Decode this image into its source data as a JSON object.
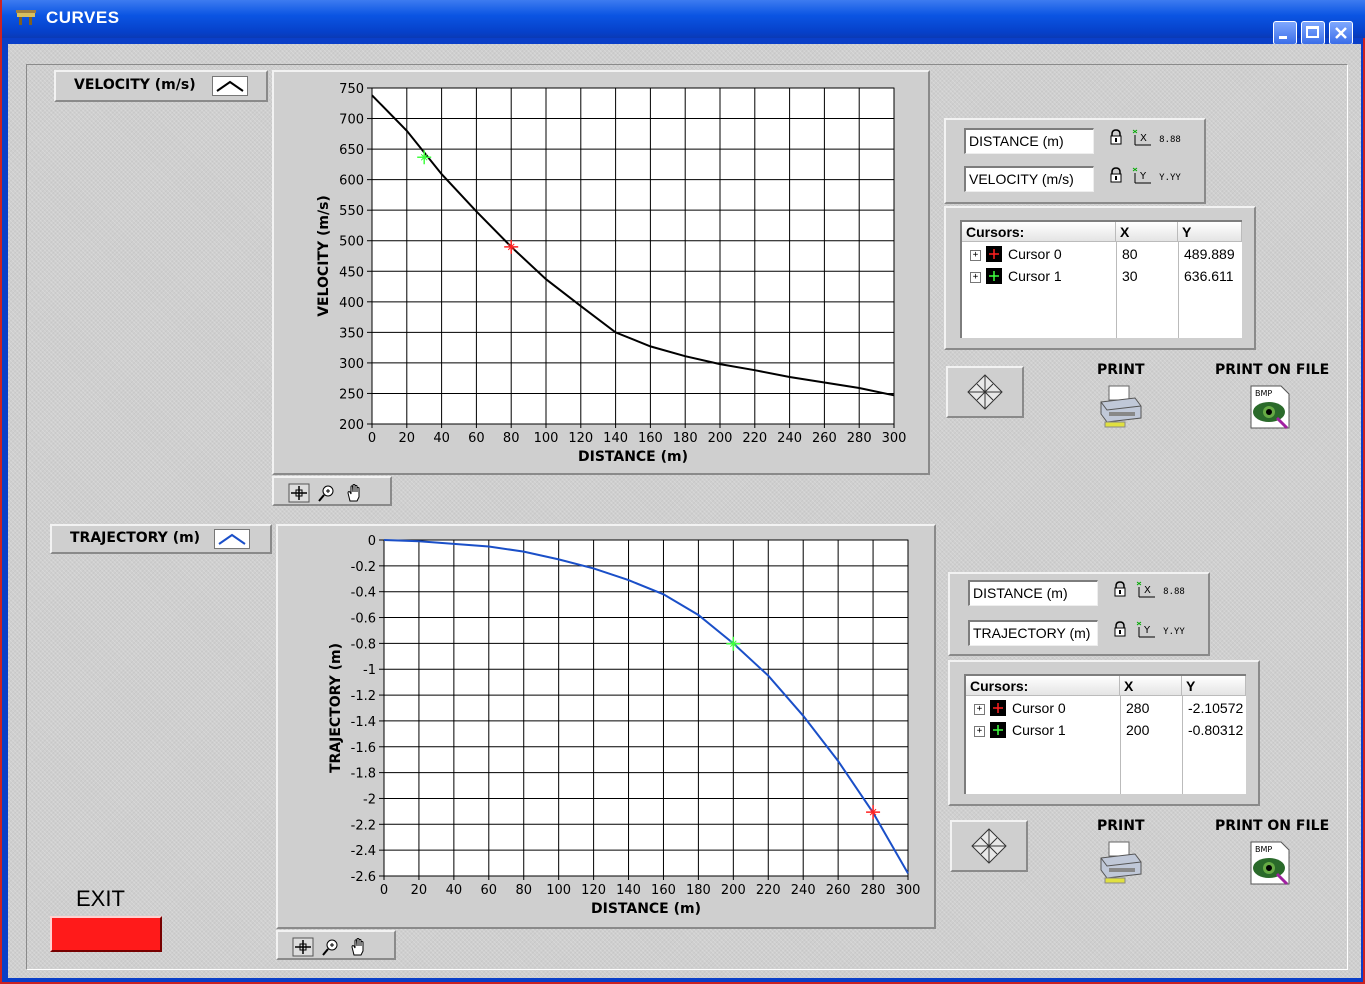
{
  "window": {
    "title": "CURVES"
  },
  "velocity_panel": {
    "legend_label": "VELOCITY (m/s)",
    "x_field": "DISTANCE (m)",
    "y_field": "VELOCITY (m/s)",
    "table": {
      "headers": [
        "Cursors:",
        "X",
        "Y"
      ],
      "rows": [
        {
          "name": "Cursor 0",
          "x": "80",
          "y": "489.889",
          "color": "#ff2020"
        },
        {
          "name": "Cursor 1",
          "x": "30",
          "y": "636.611",
          "color": "#40ff40"
        }
      ]
    },
    "print_label": "PRINT",
    "print_file_label": "PRINT ON FILE"
  },
  "trajectory_panel": {
    "legend_label": "TRAJECTORY (m)",
    "x_field": "DISTANCE (m)",
    "y_field": "TRAJECTORY (m)",
    "table": {
      "headers": [
        "Cursors:",
        "X",
        "Y"
      ],
      "rows": [
        {
          "name": "Cursor 0",
          "x": "280",
          "y": "-2.10572",
          "color": "#ff2020"
        },
        {
          "name": "Cursor 1",
          "x": "200",
          "y": "-0.80312",
          "color": "#40ff40"
        }
      ]
    },
    "print_label": "PRINT",
    "print_file_label": "PRINT ON FILE"
  },
  "icons": {
    "lock": "🔒",
    "x_format": "8.88",
    "y_format": "Y.YY",
    "bmp": "BMP"
  },
  "exit": {
    "label": "EXIT",
    "color": "#ff1a1a"
  },
  "chart_data": [
    {
      "type": "line",
      "xlabel": "DISTANCE (m)",
      "ylabel": "VELOCITY (m/s)",
      "xlim": [
        0,
        300
      ],
      "ylim": [
        200,
        750
      ],
      "xticks": [
        0,
        20,
        40,
        60,
        80,
        100,
        120,
        140,
        160,
        180,
        200,
        220,
        240,
        260,
        280,
        300
      ],
      "yticks": [
        200,
        250,
        300,
        350,
        400,
        450,
        500,
        550,
        600,
        650,
        700,
        750
      ],
      "line_color": "#000000",
      "series": [
        {
          "name": "VELOCITY (m/s)",
          "x": [
            0,
            20,
            40,
            60,
            80,
            100,
            120,
            140,
            160,
            180,
            200,
            220,
            240,
            260,
            280,
            300
          ],
          "y": [
            738,
            680,
            609,
            548,
            490,
            437,
            393,
            350,
            327,
            311,
            298,
            288,
            277,
            268,
            259,
            247
          ]
        }
      ],
      "cursors": [
        {
          "name": "Cursor 0",
          "x": 80,
          "y": 489.889,
          "color": "#ff2020"
        },
        {
          "name": "Cursor 1",
          "x": 30,
          "y": 636.611,
          "color": "#40ff40"
        }
      ]
    },
    {
      "type": "line",
      "xlabel": "DISTANCE (m)",
      "ylabel": "TRAJECTORY (m)",
      "xlim": [
        0,
        300
      ],
      "ylim": [
        -2.6,
        0
      ],
      "xticks": [
        0,
        20,
        40,
        60,
        80,
        100,
        120,
        140,
        160,
        180,
        200,
        220,
        240,
        260,
        280,
        300
      ],
      "yticks": [
        0,
        -0.2,
        -0.4,
        -0.6,
        -0.8,
        -1,
        -1.2,
        -1.4,
        -1.6,
        -1.8,
        -2,
        -2.2,
        -2.4,
        -2.6
      ],
      "line_color": "#1a4fc8",
      "series": [
        {
          "name": "TRAJECTORY (m)",
          "x": [
            0,
            20,
            40,
            60,
            80,
            100,
            120,
            140,
            160,
            180,
            200,
            220,
            240,
            260,
            280,
            300
          ],
          "y": [
            0,
            -0.01,
            -0.03,
            -0.05,
            -0.09,
            -0.15,
            -0.22,
            -0.31,
            -0.42,
            -0.58,
            -0.8,
            -1.05,
            -1.36,
            -1.71,
            -2.11,
            -2.58
          ]
        }
      ],
      "cursors": [
        {
          "name": "Cursor 0",
          "x": 280,
          "y": -2.10572,
          "color": "#ff2020"
        },
        {
          "name": "Cursor 1",
          "x": 200,
          "y": -0.80312,
          "color": "#40ff40"
        }
      ]
    }
  ]
}
